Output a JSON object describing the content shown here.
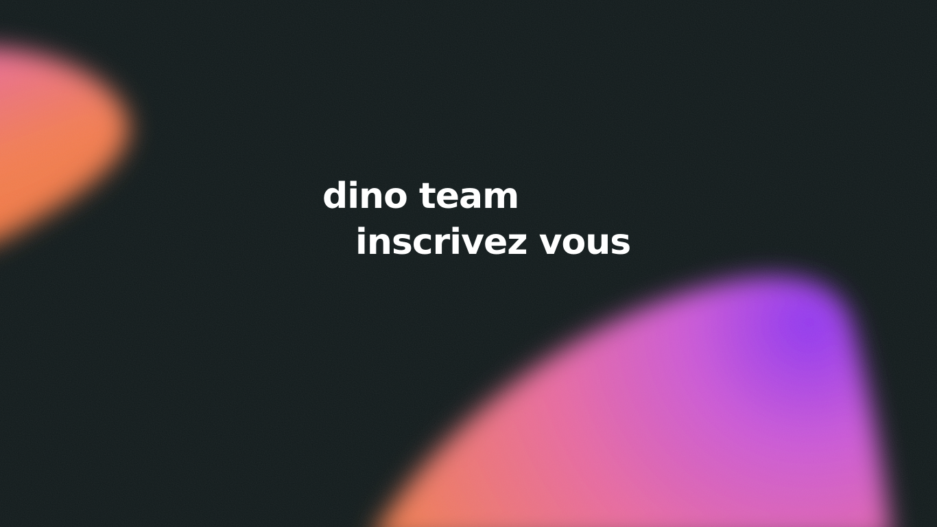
{
  "slide": {
    "line1": "dino team",
    "line2": "inscrivez vous"
  },
  "colors": {
    "background": "#0f1819",
    "blob_orange": "#f47a3c",
    "blob_pink": "#e565a6",
    "blob_purple": "#9a3ff0",
    "text": "#ffffff"
  }
}
